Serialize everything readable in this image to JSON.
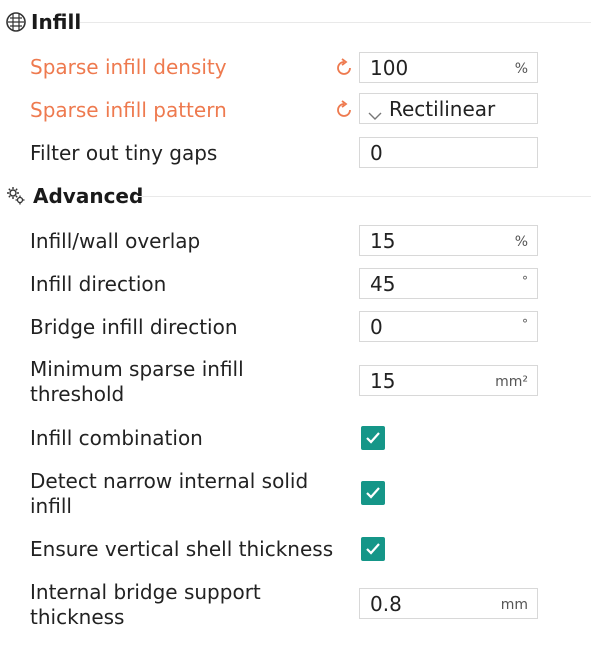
{
  "sections": {
    "infill": {
      "title": "Infill"
    },
    "advanced": {
      "title": "Advanced"
    }
  },
  "infill": {
    "sparse_density": {
      "label": "Sparse infill density",
      "value": "100",
      "unit": "%"
    },
    "sparse_pattern": {
      "label": "Sparse infill pattern",
      "value": "Rectilinear"
    },
    "filter_gaps": {
      "label": "Filter out tiny gaps",
      "value": "0"
    }
  },
  "advanced": {
    "wall_overlap": {
      "label": "Infill/wall overlap",
      "value": "15",
      "unit": "%"
    },
    "infill_direction": {
      "label": "Infill direction",
      "value": "45",
      "unit": "°"
    },
    "bridge_direction": {
      "label": "Bridge infill direction",
      "value": "0",
      "unit": "°"
    },
    "min_sparse_threshold": {
      "label_line1": "Minimum sparse infill",
      "label_line2": "threshold",
      "value": "15",
      "unit": "mm²"
    },
    "infill_combination": {
      "label": "Infill combination",
      "checked": true
    },
    "detect_narrow": {
      "label_line1": "Detect narrow internal solid",
      "label_line2": "infill",
      "checked": true
    },
    "ensure_vertical": {
      "label": "Ensure vertical shell thickness",
      "checked": true
    },
    "bridge_support": {
      "label_line1": "Internal bridge support",
      "label_line2": "thickness",
      "value": "0.8",
      "unit": "mm"
    }
  },
  "colors": {
    "modified_label": "#ee7a4f",
    "checkbox": "#159688",
    "field_border": "#d8d8d8"
  },
  "icons": [
    "infill-icon",
    "gear-icon",
    "reset-arrow-icon",
    "chevron-down-icon",
    "checkmark-icon"
  ]
}
